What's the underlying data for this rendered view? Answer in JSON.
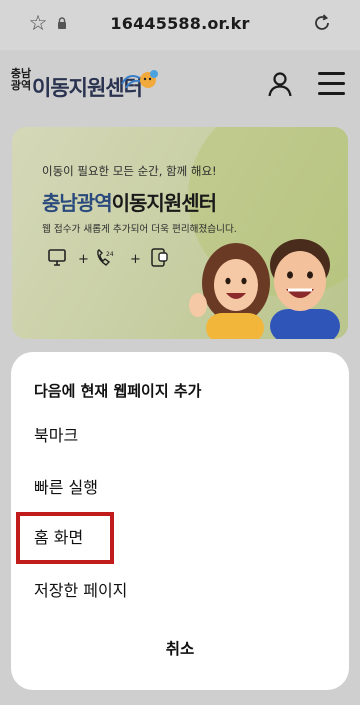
{
  "browser": {
    "url": "16445588.or.kr",
    "star_icon": "star-icon",
    "lock_icon": "lock-icon",
    "reload_icon": "reload-icon"
  },
  "header": {
    "logo_stack": [
      "충남",
      "광역"
    ],
    "logo_text": "이동지원센터",
    "user_icon": "user-icon",
    "menu_icon": "hamburger-menu-icon"
  },
  "banner": {
    "tagline": "이동이 필요한 모든 순간, 함께 해요!",
    "title_part1": "충남광역",
    "title_part2": "이동지원센터",
    "description": "웹 접수가 새롭게 추가되어 더욱 편리해졌습니다.",
    "icons": [
      "monitor-icon",
      "phone-24-icon",
      "mobile-app-icon"
    ],
    "plus": "+"
  },
  "sheet": {
    "title": "다음에 현재 웹페이지 추가",
    "items": [
      "북마크",
      "빠른 실행",
      "홈 화면",
      "저장한 페이지"
    ],
    "highlighted_item": "홈 화면",
    "cancel": "취소",
    "highlight_color": "#c11b1b"
  },
  "colors": {
    "accent_blue": "#2a4a7d",
    "banner_green": "#c7cea2"
  }
}
